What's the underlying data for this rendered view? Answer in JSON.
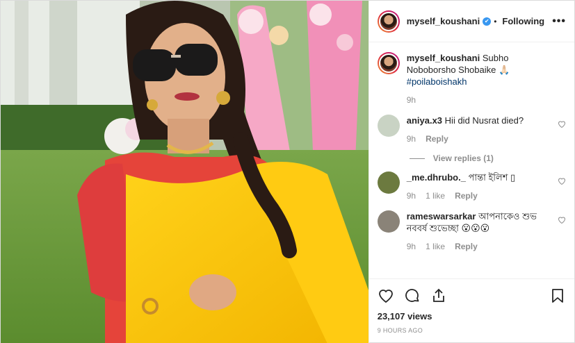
{
  "post": {
    "username": "myself_koushani",
    "verified_mark": "✔",
    "separator": "•",
    "follow_status": "Following",
    "more_options": "•••"
  },
  "caption": {
    "username": "myself_koushani",
    "text": "Subho Noboborsho Shobaike 🙏🏻",
    "hashtag": "#poilaboishakh",
    "time": "9h"
  },
  "comments": [
    {
      "username": "aniya.x3",
      "text": "Hii did Nusrat died?",
      "time": "9h",
      "likes": "",
      "reply": "Reply"
    },
    {
      "username": "_me.dhrubo._",
      "text": "পান্তা ইলিশ ▯",
      "time": "9h",
      "likes": "1 like",
      "reply": "Reply"
    },
    {
      "username": "rameswarsarkar",
      "text": "আপনাকেও শুভ নববর্ষ শুভেচ্ছা 😮😮😮",
      "time": "9h",
      "likes": "1 like",
      "reply": "Reply"
    }
  ],
  "view_replies": "View replies (1)",
  "actions": {
    "icons": [
      "heart-icon",
      "comment-icon",
      "share-icon",
      "bookmark-icon"
    ]
  },
  "views": "23,107 views",
  "posted": "9 HOURS AGO",
  "colors": {
    "accent": "#3897f0",
    "muted": "#8e8e8e",
    "text": "#262626"
  }
}
